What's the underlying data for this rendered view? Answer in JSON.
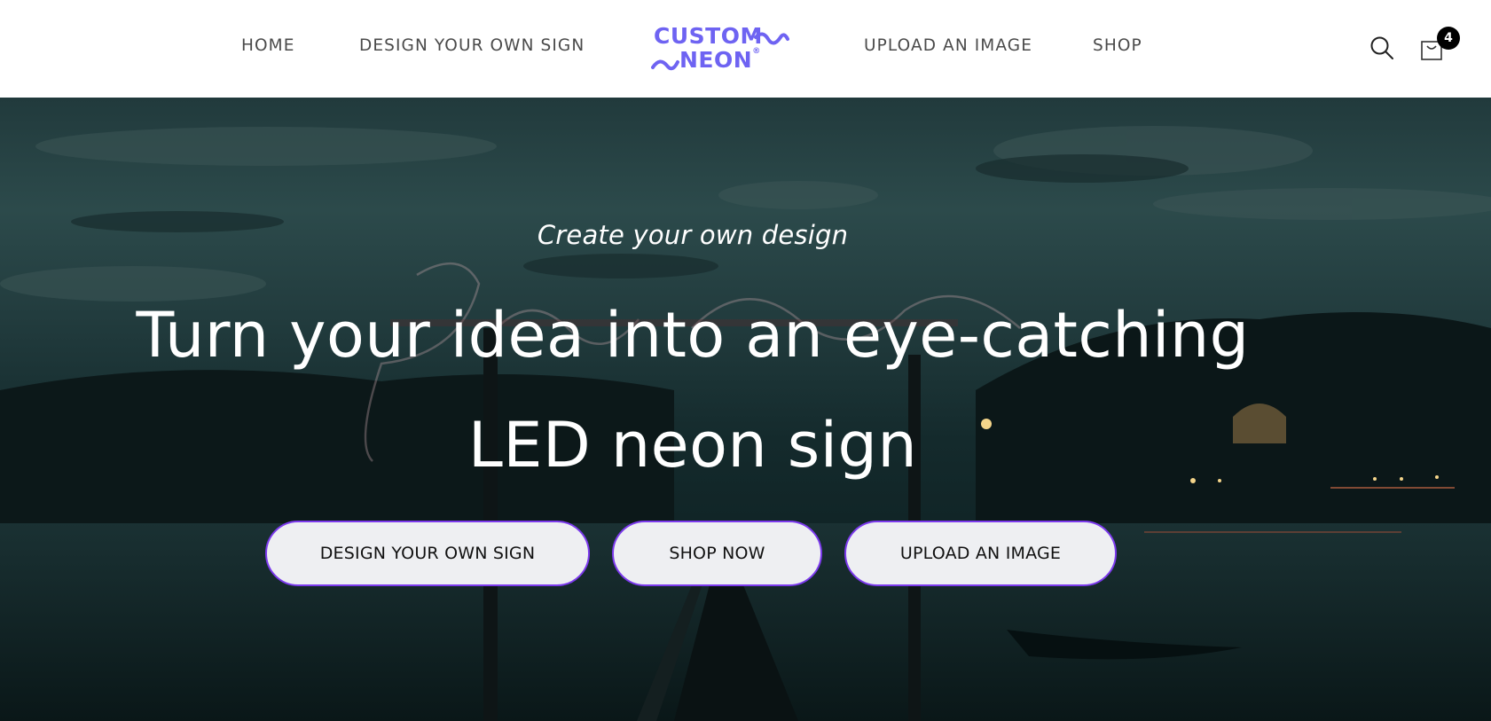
{
  "header": {
    "nav_left": [
      {
        "label": "HOME"
      },
      {
        "label": "DESIGN YOUR OWN SIGN"
      }
    ],
    "nav_right": [
      {
        "label": "UPLOAD AN IMAGE"
      },
      {
        "label": "SHOP"
      }
    ],
    "logo": {
      "line1": "CUSTOM",
      "line2": "NEON",
      "reg": "®"
    },
    "cart_count": "4",
    "icons": {
      "search": "search-icon",
      "cart": "cart-icon"
    },
    "brand_color": "#6e63f2"
  },
  "hero": {
    "kicker": "Create your own design",
    "title_line1": "Turn your idea into an eye-catching",
    "title_line2": "LED neon sign",
    "buttons": [
      {
        "label": "DESIGN YOUR OWN SIGN"
      },
      {
        "label": "SHOP NOW"
      },
      {
        "label": "UPLOAD AN IMAGE"
      }
    ],
    "button_border_color": "#7c3aed"
  }
}
